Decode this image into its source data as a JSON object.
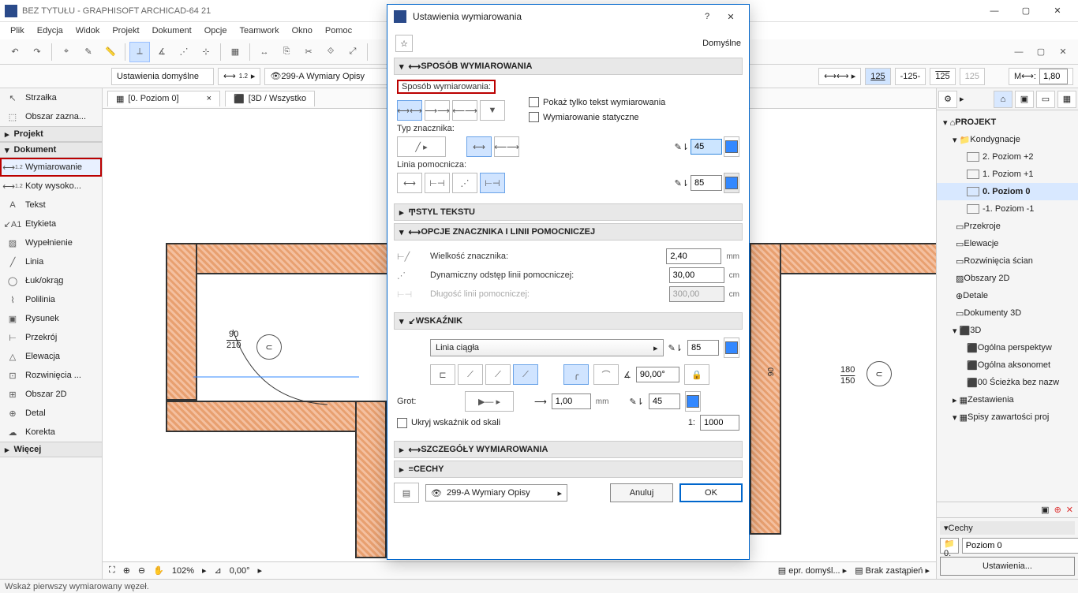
{
  "app": {
    "title": "BEZ TYTUŁU - GRAPHISOFT ARCHICAD-64 21"
  },
  "menus": [
    "Plik",
    "Edycja",
    "Widok",
    "Projekt",
    "Dokument",
    "Opcje",
    "Teamwork",
    "Okno",
    "Pomoc"
  ],
  "context": {
    "tool_name": "Strzałka",
    "tool_sub": "Obszar zazna...",
    "defaults_label": "Ustawienia domyślne",
    "layer_label": "299-A Wymiary Opisy"
  },
  "info_right": {
    "val1": "125",
    "val2": "-125-",
    "val3": "125",
    "val4": "125",
    "height": "1,80"
  },
  "tabs": {
    "tab1": "[0. Poziom 0]",
    "tab2": "[3D / Wszystko"
  },
  "toolbox": {
    "cat_project": "Projekt",
    "cat_document": "Dokument",
    "cat_more": "Więcej",
    "items": {
      "wymiarowanie": "Wymiarowanie",
      "koty": "Koty wysoko...",
      "tekst": "Tekst",
      "etykieta": "Etykieta",
      "wypelnienie": "Wypełnienie",
      "linia": "Linia",
      "luk": "Łuk/okrąg",
      "polilinia": "Polilinia",
      "rysunek": "Rysunek",
      "przekroj": "Przekrój",
      "elewacja": "Elewacja",
      "rozwiniecia": "Rozwinięcia ...",
      "obszar2d": "Obszar 2D",
      "detal": "Detal",
      "korekta": "Korekta"
    }
  },
  "navigator": {
    "root": "PROJEKT",
    "kondygnacje": "Kondygnacje",
    "poziom2": "2. Poziom +2",
    "poziom1": "1. Poziom +1",
    "poziom0": "0. Poziom 0",
    "poziomm1": "-1. Poziom -1",
    "przekroje": "Przekroje",
    "elewacje": "Elewacje",
    "rozw": "Rozwinięcia ścian",
    "obsz2d": "Obszary 2D",
    "detale": "Detale",
    "dok3d": "Dokumenty 3D",
    "g3d": "3D",
    "persp": "Ogólna perspektyw",
    "aksono": "Ogólna aksonomet",
    "sciezka": "00 Ścieżka bez nazw",
    "zest": "Zestawienia",
    "spisy": "Spisy zawartości proj"
  },
  "props": {
    "cechy": "Cechy",
    "zero": "0.",
    "poziom": "Poziom 0",
    "ustawienia": "Ustawienia..."
  },
  "canvas": {
    "d90": "90",
    "d210": "210",
    "d90b": "90",
    "d180": "180",
    "d150": "150"
  },
  "status2": {
    "zoom": "102%",
    "angle": "0,00°",
    "repr": "epr. domyśl...",
    "zast": "Brak zastąpień"
  },
  "status": "Wskaż pierwszy wymiarowany węzeł.",
  "dialog": {
    "title": "Ustawienia wymiarowania",
    "default_label": "Domyślne",
    "sec_sposob": "SPOSÓB WYMIAROWANIA",
    "lbl_sposob": "Sposób wymiarowania:",
    "chk_pokaz": "Pokaż tylko tekst wymiarowania",
    "chk_statyczne": "Wymiarowanie statyczne",
    "lbl_typ": "Typ znacznika:",
    "lbl_linia_pom": "Linia pomocnicza:",
    "pen45": "45",
    "pen85": "85",
    "sec_styl": "STYL TEKSTU",
    "sec_opcje": "OPCJE ZNACZNIKA I LINII POMOCNICZEJ",
    "lbl_wielkosc": "Wielkość znacznika:",
    "val_wielkosc": "2,40",
    "u_mm": "mm",
    "lbl_dynam": "Dynamiczny odstęp linii pomocniczej:",
    "val_dynam": "30,00",
    "u_cm": "cm",
    "lbl_dlugosc": "Długość linii pomocniczej:",
    "val_dlugosc": "300,00",
    "sec_wskaznik": "WSKAŹNIK",
    "linia_ciagla": "Linia ciągła",
    "pen85b": "85",
    "angle90": "90,00°",
    "lbl_grot": "Grot:",
    "val_thick": "1,00",
    "u_mm2": "mm",
    "pen45b": "45",
    "chk_ukryj": "Ukryj wskaźnik od skali",
    "scale_prefix": "1:",
    "scale": "1000",
    "sec_szcz": "SZCZEGÓŁY WYMIAROWANIA",
    "sec_cechy": "CECHY",
    "layer_label": "299-A Wymiary Opisy",
    "btn_cancel": "Anuluj",
    "btn_ok": "OK"
  }
}
